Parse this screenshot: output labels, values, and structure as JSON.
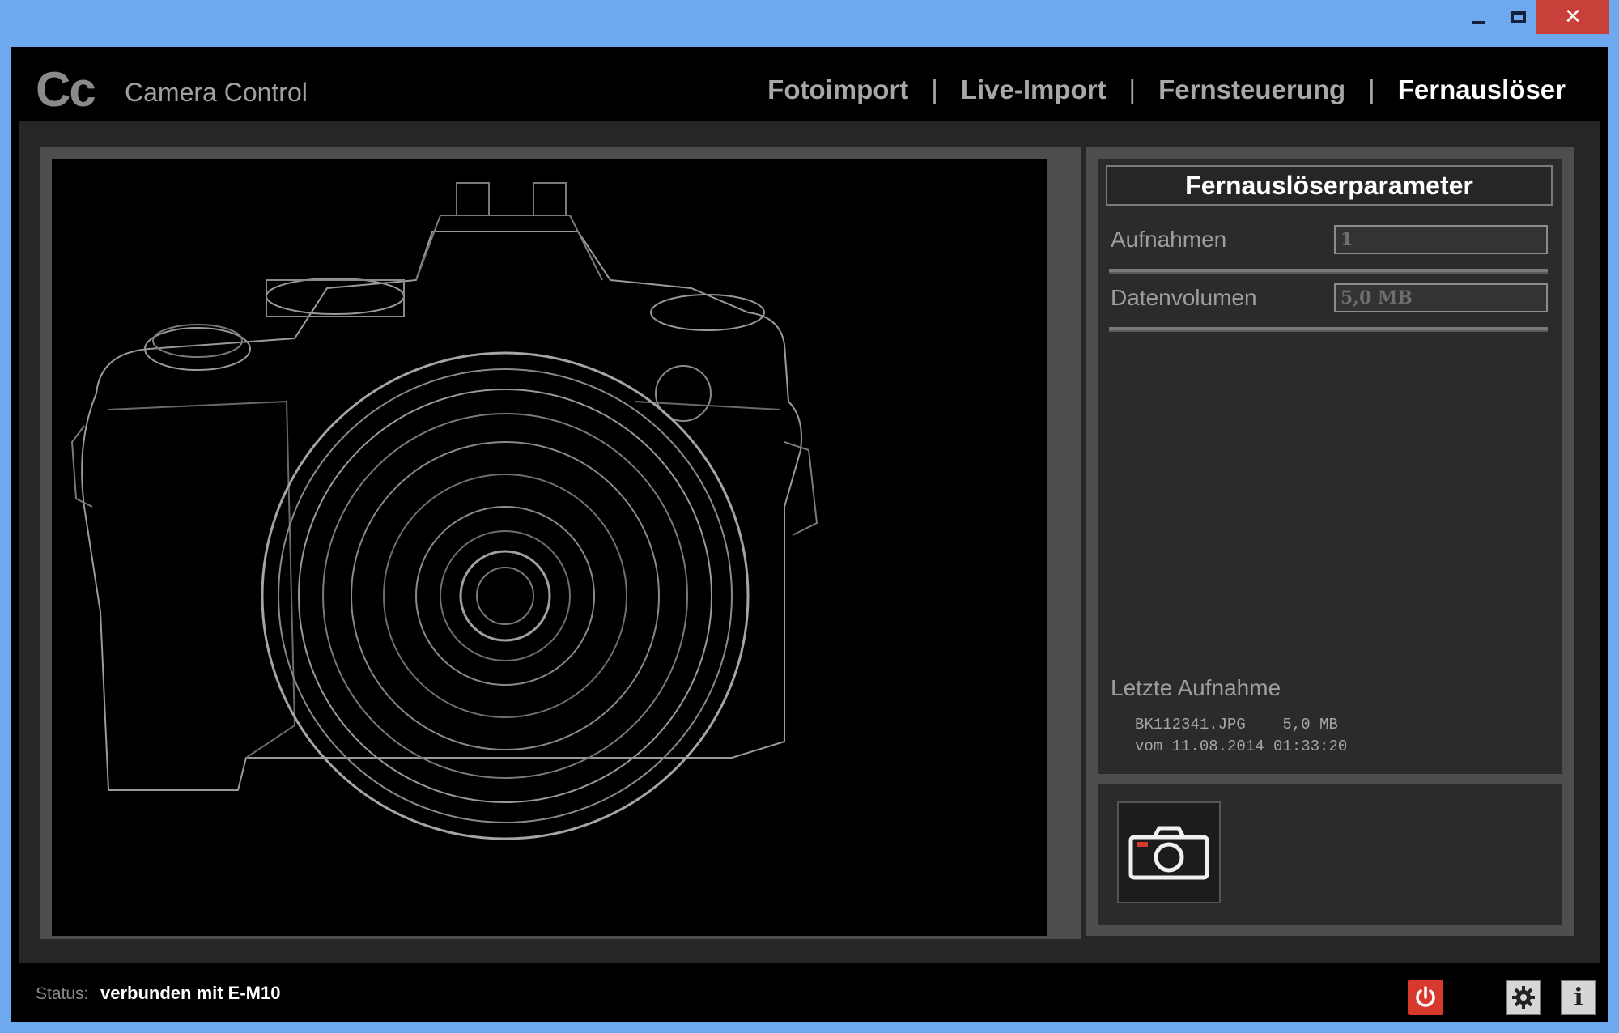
{
  "app": {
    "logo": "Cc",
    "name": "Camera Control"
  },
  "window_controls": {
    "close_glyph": "✕"
  },
  "nav": {
    "tabs": [
      {
        "label": "Fotoimport",
        "active": false
      },
      {
        "label": "Live-Import",
        "active": false
      },
      {
        "label": "Fernsteuerung",
        "active": false
      },
      {
        "label": "Fernauslöser",
        "active": true
      }
    ],
    "separator": "|"
  },
  "panel": {
    "title": "Fernauslöserparameter",
    "fields": [
      {
        "label": "Aufnahmen",
        "value": "1"
      },
      {
        "label": "Datenvolumen",
        "value": "5,0 MB"
      }
    ],
    "last_capture": {
      "title": "Letzte Aufnahme",
      "line1": "BK112341.JPG    5,0 MB",
      "line2": "vom 11.08.2014 01:33:20"
    }
  },
  "status": {
    "label": "Status:",
    "value": "verbunden mit E-M10"
  },
  "icons": {
    "info_glyph": "i"
  },
  "colors": {
    "accent_red": "#d8392d",
    "background": "#000000",
    "panel_gray": "#4e4e4e",
    "titlebar_blue": "#6ea8ee"
  }
}
